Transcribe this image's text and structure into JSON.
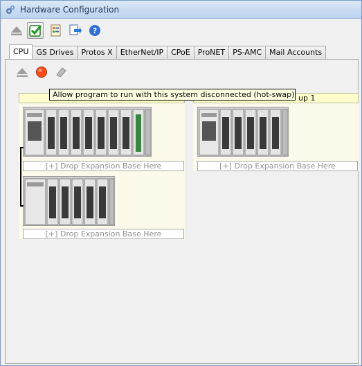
{
  "window": {
    "title": "Hardware Configuration"
  },
  "toolbar": {
    "buttons": [
      {
        "icon": "eject-icon",
        "checked": false
      },
      {
        "icon": "green-check-icon",
        "checked": true
      },
      {
        "icon": "document-list-icon",
        "checked": false
      },
      {
        "icon": "import-arrow-icon",
        "checked": false
      },
      {
        "icon": "help-icon",
        "checked": false
      }
    ]
  },
  "tabs": [
    "CPU",
    "GS Drives",
    "Protos X",
    "EtherNet/IP",
    "CPoE",
    "ProNET",
    "PS-AMC",
    "Mail Accounts"
  ],
  "active_tab": "CPU",
  "cpu_toolbar": [
    {
      "icon": "eject-icon"
    },
    {
      "icon": "red-record-icon"
    },
    {
      "icon": "eraser-icon"
    }
  ],
  "groups": [
    {
      "header": "",
      "drop_label": "[+] Drop Expansion Base Here",
      "expansion_drop_label": "[+] Drop Expansion Base Here"
    },
    {
      "header": "up 1",
      "drop_label": "[+] Drop Expansion Base Here"
    }
  ],
  "tooltip": "Allow program to run with this system disconnected (hot-swap)",
  "colors": {
    "title_bar": "#c8daf2",
    "group_header": "#ffffcc",
    "group_body": "#fbfaea",
    "tooltip": "#ffffe1",
    "record": "#ff4a1a"
  }
}
